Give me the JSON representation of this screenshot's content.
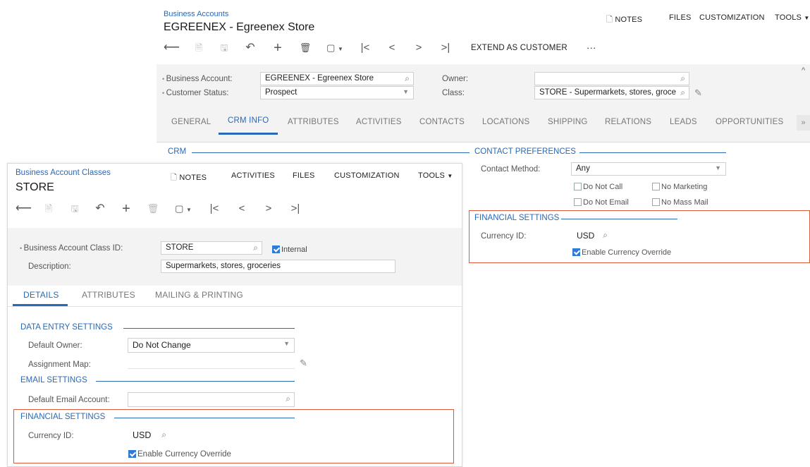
{
  "back": {
    "breadcrumb": "Business Accounts",
    "title": "EGREENEX - Egreenex Store",
    "top_buttons": {
      "notes": "NOTES",
      "files": "FILES",
      "customization": "CUSTOMIZATION",
      "tools": "TOOLS"
    },
    "toolbar_extend": "EXTEND AS CUSTOMER",
    "toolbar_more": "···",
    "form": {
      "business_account_label": "Business Account:",
      "business_account_value": "EGREENEX - Egreenex Store",
      "customer_status_label": "Customer Status:",
      "customer_status_value": "Prospect",
      "owner_label": "Owner:",
      "owner_value": "",
      "class_label": "Class:",
      "class_value": "STORE - Supermarkets, stores, groce"
    },
    "tabs": [
      "GENERAL",
      "CRM INFO",
      "ATTRIBUTES",
      "ACTIVITIES",
      "CONTACTS",
      "LOCATIONS",
      "SHIPPING",
      "RELATIONS",
      "LEADS",
      "OPPORTUNITIES"
    ],
    "active_tab": "CRM INFO",
    "crm_section": "CRM",
    "contact_prefs": {
      "section": "CONTACT PREFERENCES",
      "method_label": "Contact Method:",
      "method_value": "Any",
      "do_not_call": "Do Not Call",
      "no_marketing": "No Marketing",
      "do_not_email": "Do Not Email",
      "no_mass_mail": "No Mass Mail"
    },
    "financial": {
      "section": "FINANCIAL SETTINGS",
      "currency_label": "Currency ID:",
      "currency_value": "USD",
      "override_label": "Enable Currency Override",
      "override_checked": true
    }
  },
  "front": {
    "breadcrumb": "Business Account Classes",
    "title": "STORE",
    "top_buttons": {
      "notes": "NOTES",
      "activities": "ACTIVITIES",
      "files": "FILES",
      "customization": "CUSTOMIZATION",
      "tools": "TOOLS"
    },
    "form": {
      "class_id_label": "Business Account Class ID:",
      "class_id_value": "STORE",
      "internal_label": "Internal",
      "internal_checked": true,
      "description_label": "Description:",
      "description_value": "Supermarkets, stores, groceries"
    },
    "tabs": [
      "DETAILS",
      "ATTRIBUTES",
      "MAILING & PRINTING"
    ],
    "active_tab": "DETAILS",
    "data_entry": {
      "section": "DATA ENTRY SETTINGS",
      "owner_label": "Default Owner:",
      "owner_value": "Do Not Change",
      "assignment_label": "Assignment Map:",
      "assignment_value": ""
    },
    "email": {
      "section": "EMAIL SETTINGS",
      "account_label": "Default Email Account:",
      "account_value": ""
    },
    "financial": {
      "section": "FINANCIAL SETTINGS",
      "currency_label": "Currency ID:",
      "currency_value": "USD",
      "override_label": "Enable Currency Override",
      "override_checked": true
    }
  },
  "colors": {
    "accent": "#2a69b5",
    "highlight_border": "#e05a3a",
    "checkbox": "#2f7bd6"
  },
  "icons": [
    "notes-icon",
    "back-arrow-icon",
    "save-icon",
    "undo-icon",
    "plus-icon",
    "trash-icon",
    "copy-icon",
    "first-icon",
    "prev-icon",
    "next-icon",
    "last-icon",
    "search-icon",
    "pencil-icon",
    "dropdown-icon",
    "collapse-icon"
  ]
}
